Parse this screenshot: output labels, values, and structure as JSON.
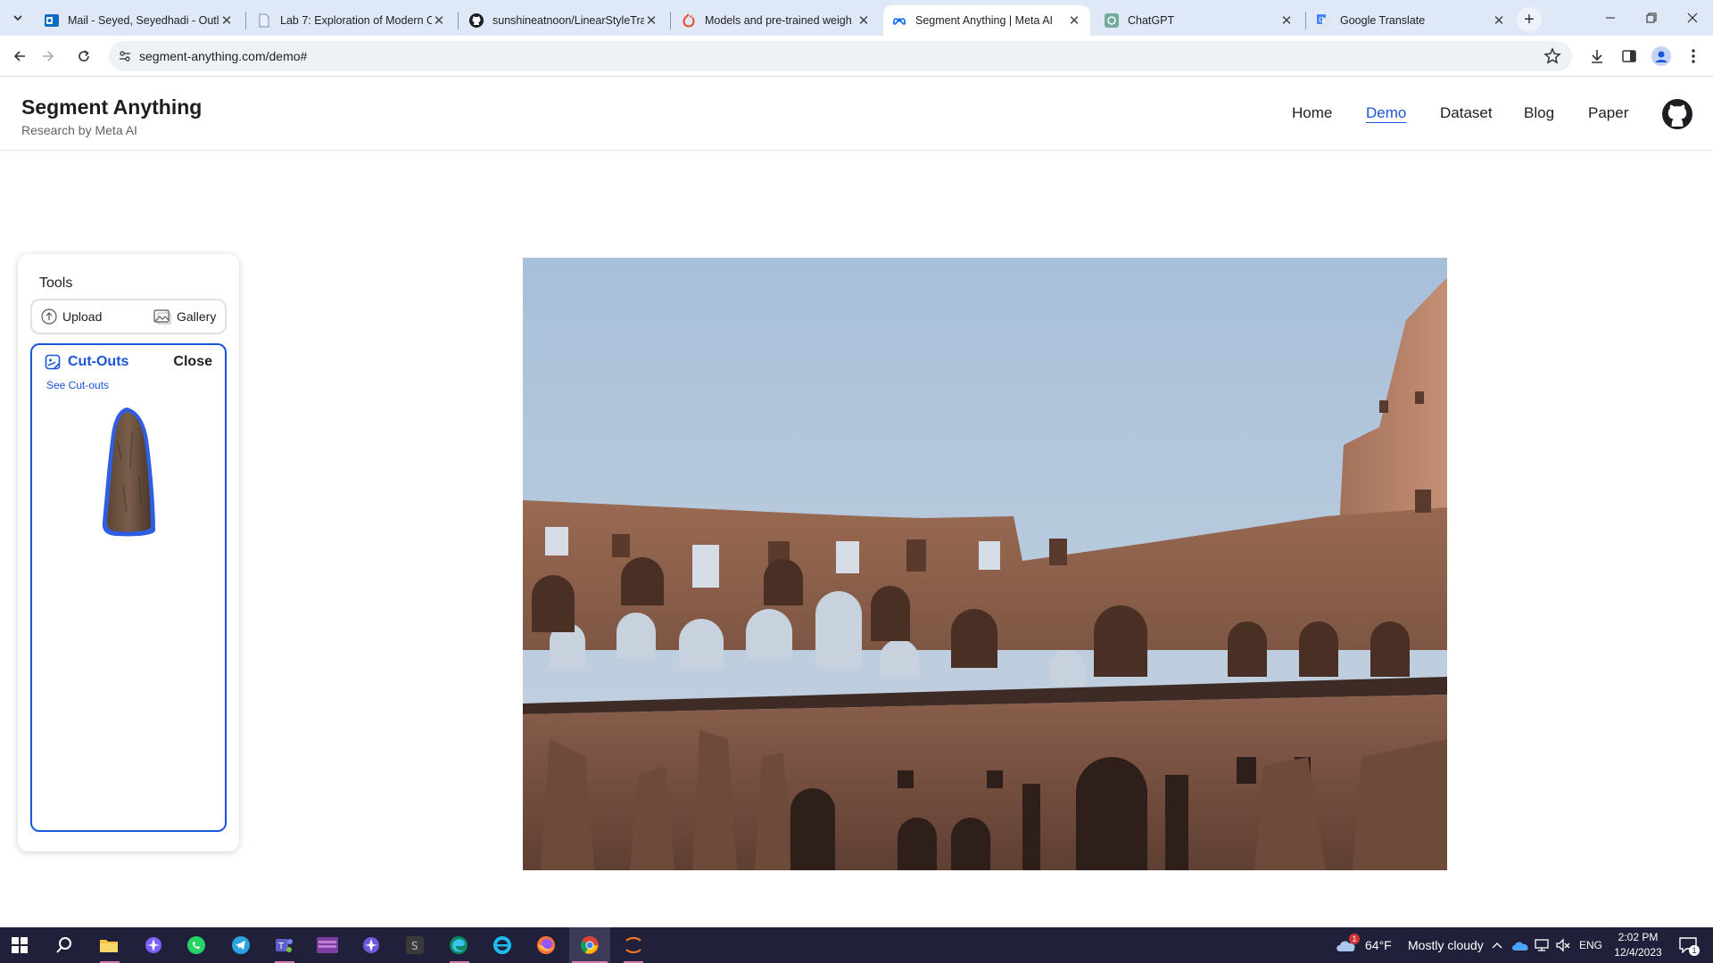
{
  "browser": {
    "tabs": [
      {
        "title": "Mail - Seyed, Seyedhadi - Outl",
        "icon": "outlook-icon"
      },
      {
        "title": "Lab 7: Exploration of Modern C",
        "icon": "document-icon"
      },
      {
        "title": "sunshineatnoon/LinearStyleTra",
        "icon": "github-icon"
      },
      {
        "title": "Models and pre-trained weigh",
        "icon": "pytorch-icon"
      },
      {
        "title": "Segment Anything | Meta AI",
        "icon": "meta-icon"
      },
      {
        "title": "ChatGPT",
        "icon": "chatgpt-icon"
      },
      {
        "title": "Google Translate",
        "icon": "google-translate-icon"
      }
    ],
    "active_tab_index": 4,
    "url": "segment-anything.com/demo#"
  },
  "site": {
    "title": "Segment Anything",
    "subtitle": "Research by Meta AI",
    "nav": [
      "Home",
      "Demo",
      "Dataset",
      "Blog",
      "Paper"
    ],
    "active_nav": "Demo"
  },
  "tools": {
    "title": "Tools",
    "upload_label": "Upload",
    "gallery_label": "Gallery",
    "cutouts": {
      "title": "Cut-Outs",
      "close_label": "Close",
      "see_link": "See Cut-outs"
    }
  },
  "taskbar": {
    "weather_temp": "64°F",
    "weather_desc": "Mostly cloudy",
    "weather_badge": "1",
    "language": "ENG",
    "time": "2:02 PM",
    "date": "12/4/2023",
    "notification_count": "1"
  },
  "colors": {
    "accent": "#1a56db",
    "tabstrip": "#dfe8f7",
    "taskbar": "#20203a"
  }
}
